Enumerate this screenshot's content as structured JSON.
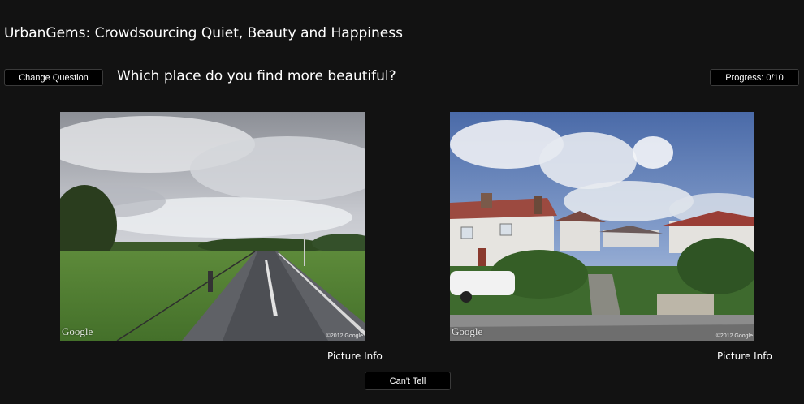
{
  "header": {
    "title": "UrbanGems: Crowdsourcing Quiet, Beauty and Happiness"
  },
  "toolbar": {
    "change_question_label": "Change Question",
    "question": "Which place do you find more beautiful?",
    "progress_label": "Progress: 0/10"
  },
  "images": {
    "left": {
      "watermark": "Google",
      "copyright": "©2012 Google",
      "info_label": "Picture Info"
    },
    "right": {
      "watermark": "Google",
      "copyright": "©2012 Google",
      "info_label": "Picture Info"
    }
  },
  "footer": {
    "cant_tell_label": "Can't Tell"
  },
  "colors": {
    "background": "#121212",
    "button_bg": "#000000",
    "text": "#ffffff"
  }
}
